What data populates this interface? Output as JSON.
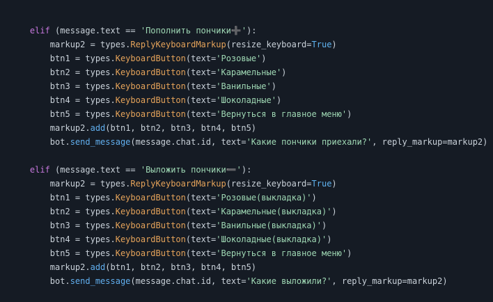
{
  "block1": {
    "header": [
      "elif",
      " (message.text == ",
      "'Пополнить пончики➕'",
      "):"
    ],
    "lines": [
      [
        "    markup2 = types.",
        "ReplyKeyboardMarkup",
        "(resize_keyboard=",
        "True",
        ")"
      ],
      [
        "    btn1 = types.",
        "KeyboardButton",
        "(text=",
        "'Розовые'",
        ")"
      ],
      [
        "    btn2 = types.",
        "KeyboardButton",
        "(text=",
        "'Карамельные'",
        ")"
      ],
      [
        "    btn3 = types.",
        "KeyboardButton",
        "(text=",
        "'Ванильные'",
        ")"
      ],
      [
        "    btn4 = types.",
        "KeyboardButton",
        "(text=",
        "'Шоколадные'",
        ")"
      ],
      [
        "    btn5 = types.",
        "KeyboardButton",
        "(text=",
        "'Вернуться в главное меню'",
        ")"
      ]
    ],
    "add_line": [
      "    markup2.",
      "add",
      "(btn1, btn2, btn3, btn4, btn5)"
    ],
    "send_line": [
      "    bot.",
      "send_message",
      "(message.chat.id, text=",
      "'Какие пончики приехали?'",
      ", reply_markup=markup2)"
    ]
  },
  "block2": {
    "header": [
      "elif",
      " (message.text == ",
      "'Выложить пончики➖'",
      "):"
    ],
    "lines": [
      [
        "    markup2 = types.",
        "ReplyKeyboardMarkup",
        "(resize_keyboard=",
        "True",
        ")"
      ],
      [
        "    btn1 = types.",
        "KeyboardButton",
        "(text=",
        "'Розовые(выкладка)'",
        ")"
      ],
      [
        "    btn2 = types.",
        "KeyboardButton",
        "(text=",
        "'Карамельные(выкладка)'",
        ")"
      ],
      [
        "    btn3 = types.",
        "KeyboardButton",
        "(text=",
        "'Ванильные(выкладка)'",
        ")"
      ],
      [
        "    btn4 = types.",
        "KeyboardButton",
        "(text=",
        "'Шоколадные(выкладка)'",
        ")"
      ],
      [
        "    btn5 = types.",
        "KeyboardButton",
        "(text=",
        "'Вернуться в главное меню'",
        ")"
      ]
    ],
    "add_line": [
      "    markup2.",
      "add",
      "(btn1, btn2, btn3, btn4, btn5)"
    ],
    "send_line": [
      "    bot.",
      "send_message",
      "(message.chat.id, text=",
      "'Какие выложили?'",
      ", reply_markup=markup2)"
    ]
  },
  "colors": {
    "background": "#151b24",
    "keyword": "#c678dd",
    "string": "#9fd8b4",
    "class_name": "#e5a35a",
    "method": "#61afef",
    "constant": "#5fb3f0",
    "plain": "#c9d1d9"
  }
}
